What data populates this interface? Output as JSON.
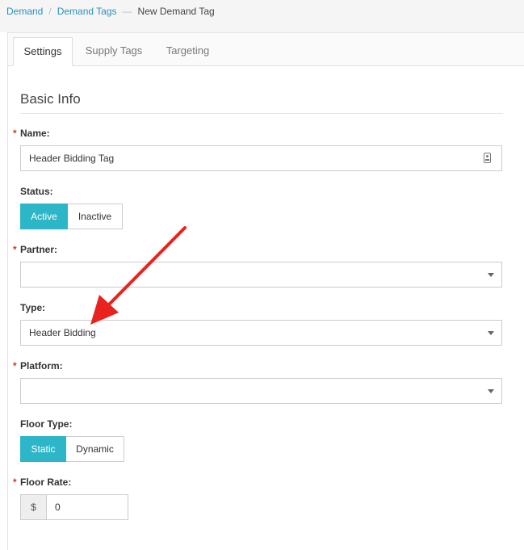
{
  "breadcrumb": {
    "item1": "Demand",
    "item2": "Demand Tags",
    "separator2": "—",
    "current": "New Demand Tag"
  },
  "tabs": [
    {
      "label": "Settings",
      "active": true
    },
    {
      "label": "Supply Tags",
      "active": false
    },
    {
      "label": "Targeting",
      "active": false
    }
  ],
  "section": {
    "title": "Basic Info"
  },
  "fields": {
    "name": {
      "label": "Name:",
      "required": true,
      "value": "Header Bidding Tag"
    },
    "status": {
      "label": "Status:",
      "options": [
        "Active",
        "Inactive"
      ],
      "selected": "Active"
    },
    "partner": {
      "label": "Partner:",
      "required": true,
      "value": ""
    },
    "type": {
      "label": "Type:",
      "value": "Header Bidding"
    },
    "platform": {
      "label": "Platform:",
      "required": true,
      "value": ""
    },
    "floor_type": {
      "label": "Floor Type:",
      "options": [
        "Static",
        "Dynamic"
      ],
      "selected": "Static"
    },
    "floor_rate": {
      "label": "Floor Rate:",
      "required": true,
      "prefix": "$",
      "value": "0"
    }
  },
  "required_marker": "*",
  "colors": {
    "accent": "#2cb6c7",
    "link": "#2a8fbd",
    "required": "#d9302c",
    "annotation_arrow": "#e8231d"
  },
  "icons": {
    "name_field": "contact-card-icon",
    "dropdown": "caret-down-icon"
  }
}
